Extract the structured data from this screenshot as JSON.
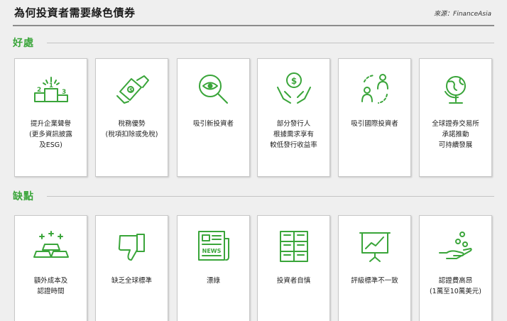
{
  "header": {
    "title": "為何投資者需要綠色債券",
    "source": "來源：FinanceAsia"
  },
  "pros": {
    "heading": "好處",
    "items": [
      {
        "icon": "podium-icon",
        "label": "提升企業聲譽\n(更多資訊披露\n及ESG)"
      },
      {
        "icon": "money-hand-icon",
        "label": "稅務優勢\n(稅項扣除或免稅)"
      },
      {
        "icon": "magnifier-eye-icon",
        "label": "吸引新投資者"
      },
      {
        "icon": "hands-coin-icon",
        "label": "部分發行人\n根據需求享有\n較低發行收益率"
      },
      {
        "icon": "global-investors-icon",
        "label": "吸引國際投資者"
      },
      {
        "icon": "globe-stand-icon",
        "label": "全球證券交易所\n承諾推動\n可持續發展"
      }
    ]
  },
  "cons": {
    "heading": "缺點",
    "items": [
      {
        "icon": "gold-bars-icon",
        "label": "額外成本及\n認證時間"
      },
      {
        "icon": "thumbs-down-icon",
        "label": "缺乏全球標準"
      },
      {
        "icon": "newspaper-icon",
        "label": "漂綠"
      },
      {
        "icon": "money-stack-icon",
        "label": "投資者自慎"
      },
      {
        "icon": "chart-board-icon",
        "label": "評級標準不一致"
      },
      {
        "icon": "hand-coins-icon",
        "label": "認證費高昂\n(1萬至10萬美元)"
      }
    ]
  },
  "icon_text": {
    "place_1": "1",
    "place_2": "2",
    "place_3": "3",
    "currency": "$",
    "news": "NEWS"
  }
}
